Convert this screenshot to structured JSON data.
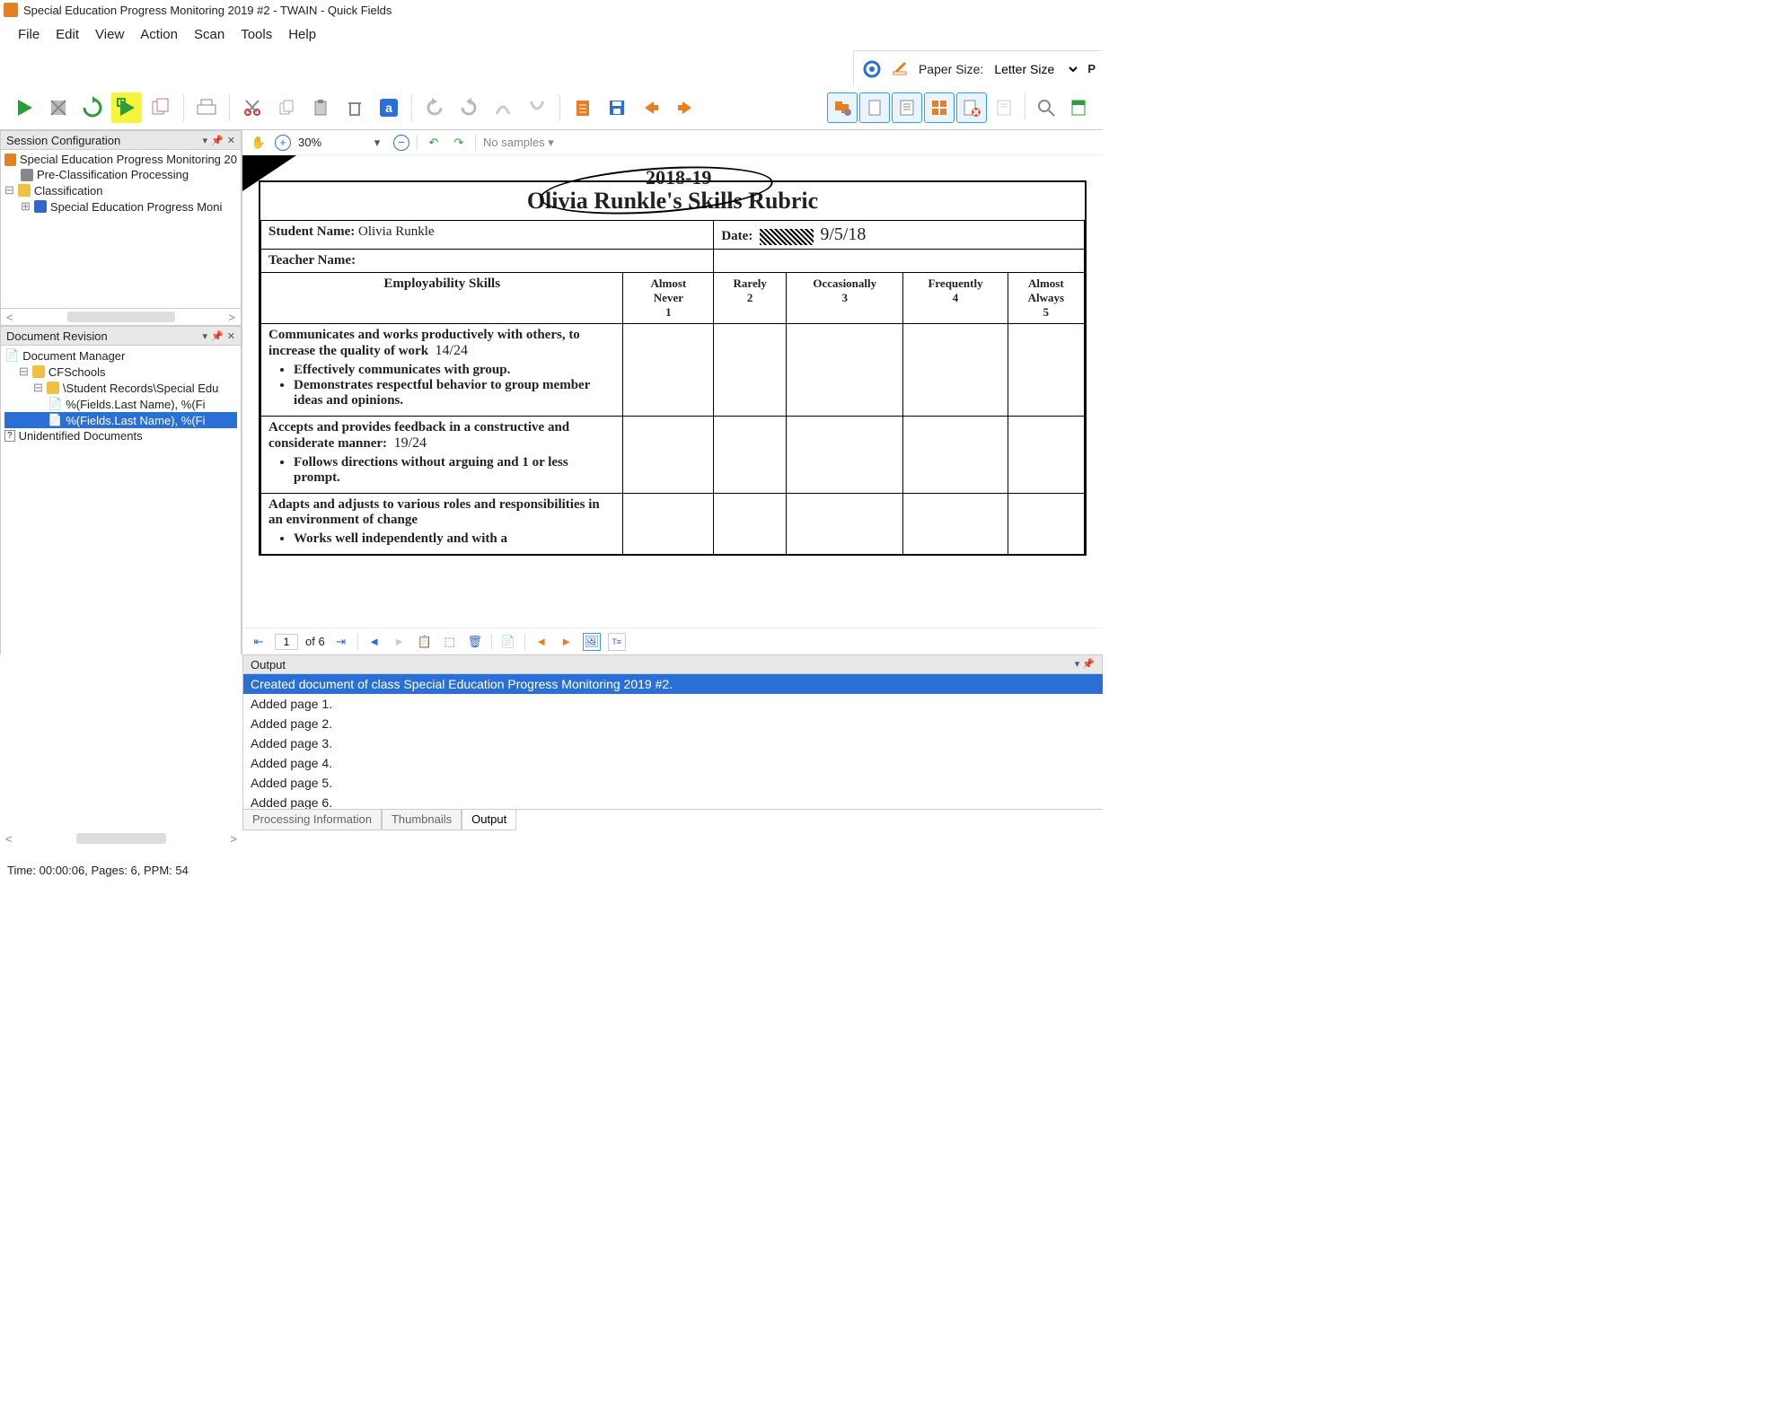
{
  "window": {
    "title": "Special Education Progress Monitoring 2019 #2 - TWAIN - Quick Fields"
  },
  "menu": {
    "items": [
      "File",
      "Edit",
      "View",
      "Action",
      "Scan",
      "Tools",
      "Help"
    ]
  },
  "uppertools": {
    "paper_label": "Paper Size:",
    "paper_value": "Letter Size"
  },
  "left": {
    "session_header": "Session Configuration",
    "session_tree": {
      "root": "Special Education Progress Monitoring 20",
      "pre": "Pre-Classification Processing",
      "cls": "Classification",
      "child": "Special Education Progress Moni"
    },
    "docrev_header": "Document Revision",
    "docrev": {
      "root": "Document Manager",
      "n1": "CFSchools",
      "n2": "\\Student Records\\Special Edu",
      "n3": "%(Fields.Last Name), %(Fi",
      "n3b": "%(Fields.Last Name), %(Fi",
      "n4": "Unidentified Documents"
    }
  },
  "viewer": {
    "zoom": "30%",
    "nosamples": "No samples",
    "page_current": "1",
    "page_of": "of 6"
  },
  "document": {
    "hand_year": "2018-19",
    "title": "Olivia Runkle's Skills Rubric",
    "student_label": "Student Name:",
    "student_value": "Olivia Runkle",
    "date_label": "Date:",
    "date_hand": "9/5/18",
    "teacher_label": "Teacher Name:",
    "col_skill": "Employability Skills",
    "cols": [
      {
        "t1": "Almost",
        "t2": "Never",
        "n": "1"
      },
      {
        "t1": "Rarely",
        "t2": "",
        "n": "2"
      },
      {
        "t1": "Occasionally",
        "t2": "",
        "n": "3"
      },
      {
        "t1": "Frequently",
        "t2": "",
        "n": "4"
      },
      {
        "t1": "Almost",
        "t2": "Always",
        "n": "5"
      }
    ],
    "row1": {
      "lead": "Communicates and works productively with others, to increase the quality of work",
      "hand": "14/24",
      "b1": "Effectively communicates with group.",
      "b2": "Demonstrates respectful behavior to group member ideas and opinions."
    },
    "row2": {
      "lead": "Accepts and provides feedback in a constructive and considerate manner:",
      "hand": "19/24",
      "b1": "Follows directions without arguing and 1 or less prompt."
    },
    "row3": {
      "lead": "Adapts and adjusts to various roles and responsibilities in an environment of change",
      "b1": "Works well independently and with a"
    }
  },
  "output": {
    "header": "Output",
    "lines": [
      "Created document of class Special Education Progress Monitoring 2019 #2.",
      "Added page 1.",
      "Added page 2.",
      "Added page 3.",
      "Added page 4.",
      "Added page 5.",
      "Added page 6."
    ],
    "tabs": [
      "Processing Information",
      "Thumbnails",
      "Output"
    ]
  },
  "status": "Time: 00:00:06, Pages: 6, PPM: 54"
}
